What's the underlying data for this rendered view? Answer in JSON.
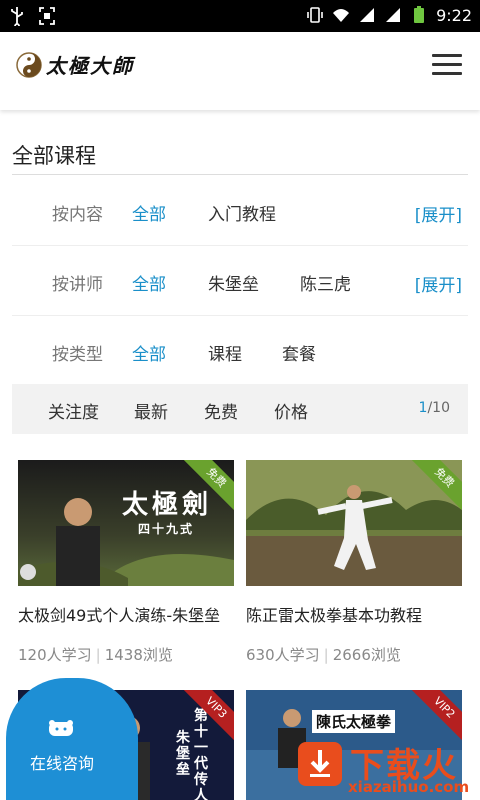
{
  "status_bar": {
    "time": "9:22"
  },
  "app": {
    "logo_text": "太極大師"
  },
  "section": {
    "title": "全部课程"
  },
  "filters": [
    {
      "label": "按内容",
      "options": [
        "全部",
        "入门教程"
      ],
      "active": 0,
      "expand": "[展开]"
    },
    {
      "label": "按讲师",
      "options": [
        "全部",
        "朱堡垒",
        "陈三虎"
      ],
      "active": 0,
      "expand": "[展开]"
    },
    {
      "label": "按类型",
      "options": [
        "全部",
        "课程",
        "套餐"
      ],
      "active": 0
    }
  ],
  "sort": {
    "options": [
      "关注度",
      "最新",
      "免费",
      "价格"
    ],
    "page_current": "1",
    "page_sep": "/",
    "page_total": "10"
  },
  "courses": [
    {
      "title": "太极剑49式个人演练-朱堡垒",
      "learners": "120人学习",
      "views": "1438浏览",
      "badge": "免费",
      "overlay": "太極劍",
      "overlay2": "四十九式"
    },
    {
      "title": "陈正雷太极拳基本功教程",
      "learners": "630人学习",
      "views": "2666浏览",
      "badge": "免费"
    },
    {
      "badge": "VIP3",
      "overlay": "第十一代传人",
      "overlay2": "朱堡垒"
    },
    {
      "badge": "VIP2",
      "overlay": "陳氏太極拳"
    }
  ],
  "consult": {
    "label": "在线咨询"
  },
  "watermark": {
    "text": "下载火",
    "url": "xiazaihuo.com"
  },
  "colors": {
    "accent": "#1a8fc9",
    "consult_bg": "#1e8fd5",
    "free_badge": "#6aa22e",
    "vip_badge": "#b52020",
    "watermark": "#e94d1d"
  }
}
